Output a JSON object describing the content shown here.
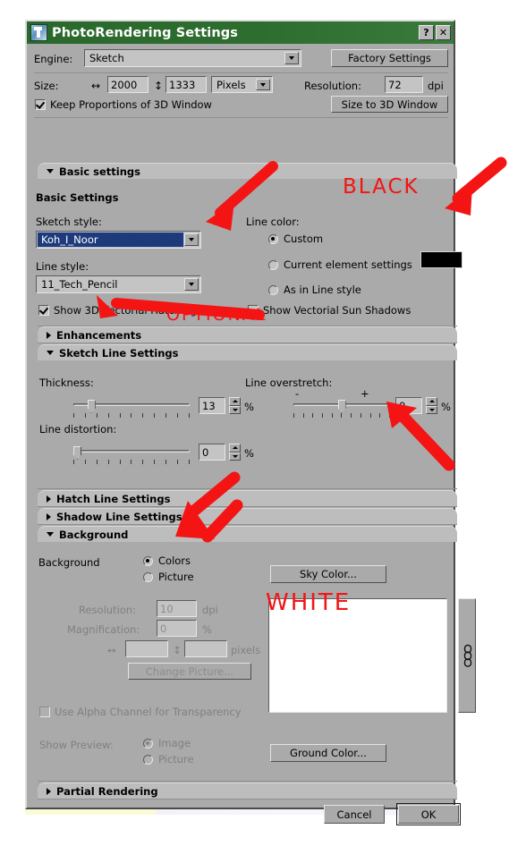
{
  "window": {
    "title": "PhotoRendering Settings",
    "icon": "app-icon",
    "help_label": "?",
    "close_label": "✕"
  },
  "top": {
    "engine_label": "Engine:",
    "engine_value": "Sketch",
    "factory_settings_label": "Factory Settings",
    "size_label": "Size:",
    "width_value": "2000",
    "height_value": "1333",
    "units_value": "Pixels",
    "resolution_label": "Resolution:",
    "resolution_value": "72",
    "dpi_label": "dpi",
    "keep_proportions_label": "Keep Proportions of 3D Window",
    "keep_proportions_checked": true,
    "size_to_3d_label": "Size to 3D Window",
    "width_icon": "↔",
    "height_icon": "↕"
  },
  "basic_section": {
    "header": "Basic settings",
    "expanded": true,
    "group_title": "Basic Settings",
    "sketch_style_label": "Sketch style:",
    "sketch_style_value": "Koh_I_Noor",
    "line_style_label": "Line style:",
    "line_style_value": "11_Tech_Pencil",
    "hatching_label": "Show 3D Vectorial Hatching",
    "hatching_checked": true,
    "line_color_label": "Line color:",
    "line_color_options": [
      {
        "label": "Custom",
        "selected": true
      },
      {
        "label": "Current element settings",
        "selected": false
      },
      {
        "label": "As in Line style",
        "selected": false
      }
    ],
    "line_color_swatch": "#000000",
    "sun_shadows_label": "Show Vectorial Sun Shadows",
    "sun_shadows_checked": false
  },
  "enhancements_section": {
    "header": "Enhancements",
    "expanded": false
  },
  "sketch_line_section": {
    "header": "Sketch Line Settings",
    "expanded": true,
    "thickness_label": "Thickness:",
    "thickness_value": "13",
    "thickness_unit": "%",
    "thickness_pos_pct": 13,
    "overstretch_label": "Line overstretch:",
    "overstretch_minus": "-",
    "overstretch_plus": "+",
    "overstretch_value": "0",
    "overstretch_unit": "%",
    "overstretch_pos_pct": 50,
    "distortion_label": "Line distortion:",
    "distortion_value": "0",
    "distortion_unit": "%",
    "distortion_pos_pct": 0
  },
  "hatch_section": {
    "header": "Hatch Line Settings",
    "expanded": false
  },
  "shadow_section": {
    "header": "Shadow Line Settings",
    "expanded": false
  },
  "background_section": {
    "header": "Background",
    "expanded": true,
    "background_label": "Background",
    "options": [
      {
        "label": "Colors",
        "selected": true
      },
      {
        "label": "Picture",
        "selected": false
      }
    ],
    "sky_color_label": "Sky Color...",
    "ground_color_label": "Ground Color...",
    "resolution_label": "Resolution:",
    "resolution_value": "10",
    "resolution_unit": "dpi",
    "magnification_label": "Magnification:",
    "magnification_value": "0",
    "magnification_unit": "%",
    "pixels_width_value": "",
    "pixels_height_value": "",
    "pixels_unit": "pixels",
    "width_icon": "↔",
    "height_icon": "↕",
    "change_picture_label": "Change Picture...",
    "alpha_label": "Use Alpha Channel for Transparency",
    "alpha_checked": false,
    "show_preview_label": "Show Preview:",
    "preview_options": [
      {
        "label": "Image",
        "selected": true
      },
      {
        "label": "Picture",
        "selected": false
      }
    ]
  },
  "partial_section": {
    "header": "Partial Rendering",
    "expanded": false
  },
  "footer": {
    "cancel_label": "Cancel",
    "ok_label": "OK"
  },
  "annotations": {
    "color": "#f41414",
    "black_text": "BLACK",
    "optional_text": "OPTIONAL",
    "white_text": "WHITE"
  }
}
